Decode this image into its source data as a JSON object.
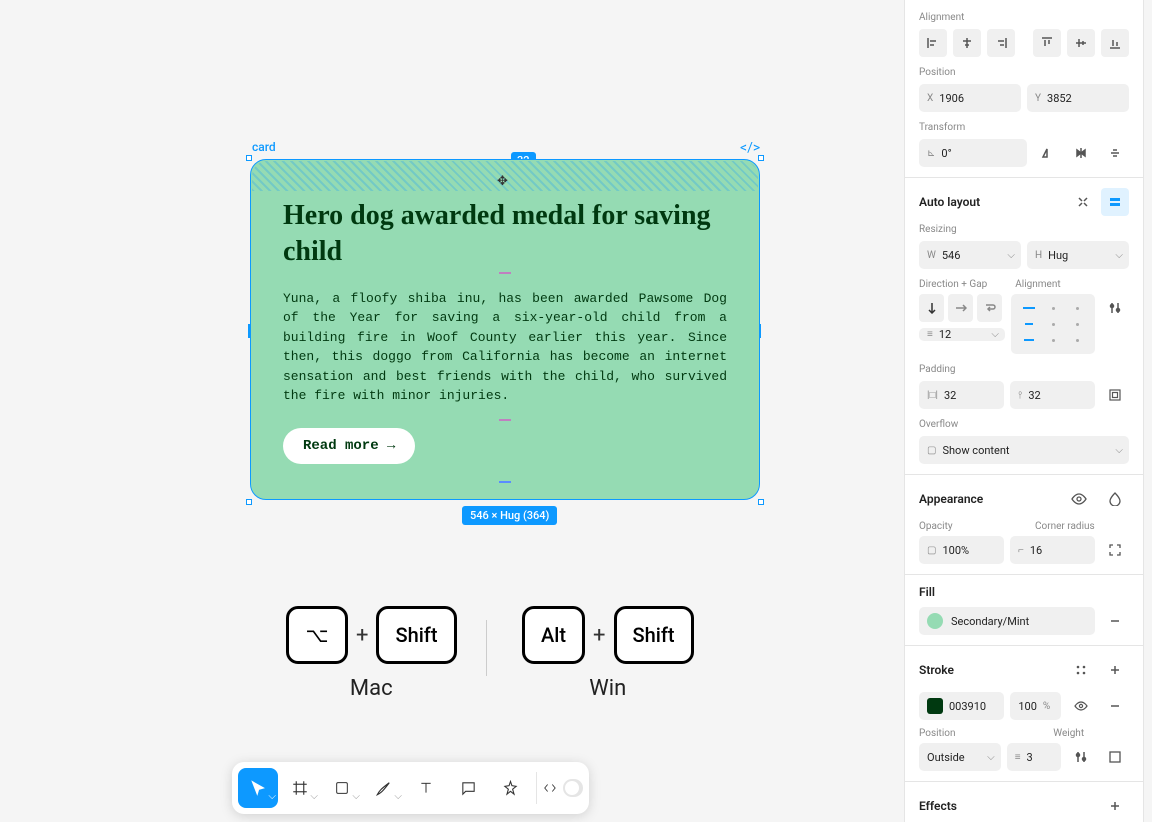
{
  "canvas": {
    "selected_layer_name": "card",
    "padding_badge_top": "32",
    "dimension_badge": "546 × Hug (364)",
    "card": {
      "title": "Hero dog awarded medal for saving child",
      "body": "Yuna, a floofy shiba inu, has been awarded Pawsome Dog of the Year for saving a six-year-old child from a building fire in Woof County earlier this year. Since then, this doggo from California has become an internet sensation and best friends with the child, who survived the fire with minor injuries.",
      "button_label": "Read more →"
    }
  },
  "kbd": {
    "mac_key1": "⌥",
    "mac_key2": "Shift",
    "win_key1": "Alt",
    "win_key2": "Shift",
    "plus": "+",
    "mac_label": "Mac",
    "win_label": "Win"
  },
  "panel": {
    "alignment_label": "Alignment",
    "position_label": "Position",
    "position": {
      "x_label": "X",
      "x": "1906",
      "y_label": "Y",
      "y": "3852"
    },
    "transform_label": "Transform",
    "transform": {
      "rotation": "0°"
    },
    "autolayout": {
      "title": "Auto layout",
      "resizing_label": "Resizing",
      "w_label": "W",
      "w": "546",
      "h_label": "H",
      "h": "Hug",
      "dir_gap_label": "Direction + Gap",
      "alignment_label": "Alignment",
      "gap": "12",
      "padding_label": "Padding",
      "pad_h": "32",
      "pad_v": "32",
      "overflow_label": "Overflow",
      "overflow": "Show content"
    },
    "appearance": {
      "title": "Appearance",
      "opacity_label": "Opacity",
      "opacity": "100%",
      "radius_label": "Corner radius",
      "radius": "16"
    },
    "fill": {
      "title": "Fill",
      "value": "Secondary/Mint",
      "color": "#95dbb3"
    },
    "stroke": {
      "title": "Stroke",
      "hex": "003910",
      "opacity": "100",
      "pct": "%",
      "position_label": "Position",
      "position": "Outside",
      "weight_label": "Weight",
      "weight": "3"
    },
    "effects": {
      "title": "Effects"
    }
  }
}
